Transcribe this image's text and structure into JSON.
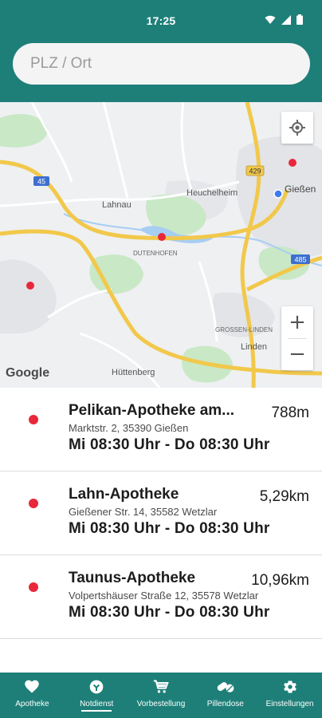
{
  "status_bar": {
    "time": "17:25",
    "icons": [
      "wifi-icon",
      "signal-icon",
      "battery-icon"
    ]
  },
  "search": {
    "placeholder": "PLZ / Ort",
    "value": ""
  },
  "map": {
    "labels": {
      "lahnau": "Lahnau",
      "heuchelheim": "Heuchelheim",
      "giessen": "Gießen",
      "dutenhofen": "DUTENHOFEN",
      "grossen_linden": "GROSSEN-LINDEN",
      "linden": "Linden",
      "huettenberg": "Hüttenberg",
      "road_45": "45",
      "road_429": "429",
      "road_485": "485",
      "attribution": "Google"
    },
    "controls": {
      "zoom_in": "+",
      "zoom_out": "−",
      "locate_icon": "my-location-icon"
    },
    "colors": {
      "water": "#a7cdf2",
      "green": "#c9e8c5",
      "highway": "#f2c84b",
      "marker": "#e8283a"
    }
  },
  "pharmacies": [
    {
      "name": "Pelikan-Apotheke am...",
      "distance": "788m",
      "address": "Marktstr. 2, 35390 Gießen",
      "hours": "Mi 08:30 Uhr - Do 08:30 Uhr"
    },
    {
      "name": "Lahn-Apotheke",
      "distance": "5,29km",
      "address": "Gießener Str. 14, 35582 Wetzlar",
      "hours": "Mi 08:30 Uhr - Do 08:30 Uhr"
    },
    {
      "name": "Taunus-Apotheke",
      "distance": "10,96km",
      "address": "Volpertshäuser Straße 12, 35578 Wetzlar",
      "hours": "Mi 08:30 Uhr - Do 08:30 Uhr"
    }
  ],
  "nav": {
    "items": [
      {
        "label": "Apotheke",
        "icon": "heart-icon",
        "active": false
      },
      {
        "label": "Notdienst",
        "icon": "emergency-icon",
        "active": true
      },
      {
        "label": "Vorbestellung",
        "icon": "cart-icon",
        "active": false
      },
      {
        "label": "Pillendose",
        "icon": "pill-icon",
        "active": false
      },
      {
        "label": "Einstellungen",
        "icon": "gear-icon",
        "active": false
      }
    ]
  },
  "colors": {
    "primary": "#1e7f79",
    "marker": "#e8283a"
  }
}
